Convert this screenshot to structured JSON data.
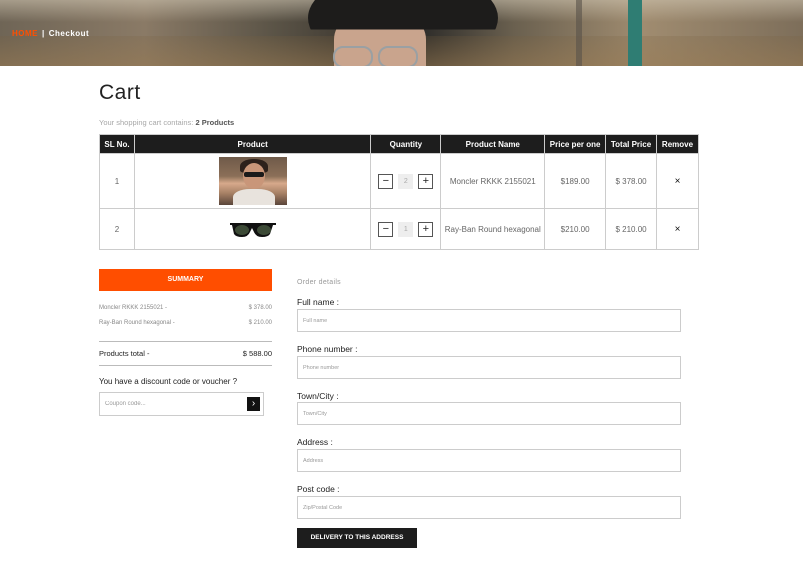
{
  "breadcrumb": {
    "home": "HOME",
    "separator": "|",
    "current": "Checkout"
  },
  "page_title": "Cart",
  "cart_summary": {
    "prefix": "Your shopping cart contains:",
    "count": "2 Products"
  },
  "table": {
    "headers": [
      "SL No.",
      "Product",
      "Quantity",
      "Product Name",
      "Price per one",
      "Total Price",
      "Remove"
    ],
    "rows": [
      {
        "sl": "1",
        "quantity": "2",
        "name": "Moncler RKKK 2155021",
        "price": "$189.00",
        "total": "$ 378.00",
        "remove": "×"
      },
      {
        "sl": "2",
        "quantity": "1",
        "name": "Ray-Ban Round hexagonal",
        "price": "$210.00",
        "total": "$ 210.00",
        "remove": "×"
      }
    ],
    "minus": "−",
    "plus": "+"
  },
  "summary": {
    "button": "SUMMARY",
    "items": [
      {
        "name": "Moncler RKKK 2155021 -",
        "price": "$ 378.00"
      },
      {
        "name": "Ray-Ban Round hexagonal -",
        "price": "$ 210.00"
      }
    ],
    "total_label": "Products total -",
    "total_value": "$ 588.00",
    "discount_label": "You have a discount code or voucher ?",
    "coupon_placeholder": "Coupon code...",
    "coupon_go": "›"
  },
  "order": {
    "title": "Order details",
    "fields": [
      {
        "label": "Full name :",
        "placeholder": "Full name"
      },
      {
        "label": "Phone number :",
        "placeholder": "Phone number"
      },
      {
        "label": "Town/City :",
        "placeholder": "Town/City"
      },
      {
        "label": "Address :",
        "placeholder": "Address"
      },
      {
        "label": "Post code :",
        "placeholder": "Zip/Postal Code"
      }
    ],
    "submit": "DELIVERY TO THIS ADDRESS"
  },
  "colors": {
    "accent": "#ff4e00",
    "dark": "#1d1d1d"
  },
  "icons": {
    "remove": "close-icon",
    "coupon_go": "chevron-right-icon"
  }
}
